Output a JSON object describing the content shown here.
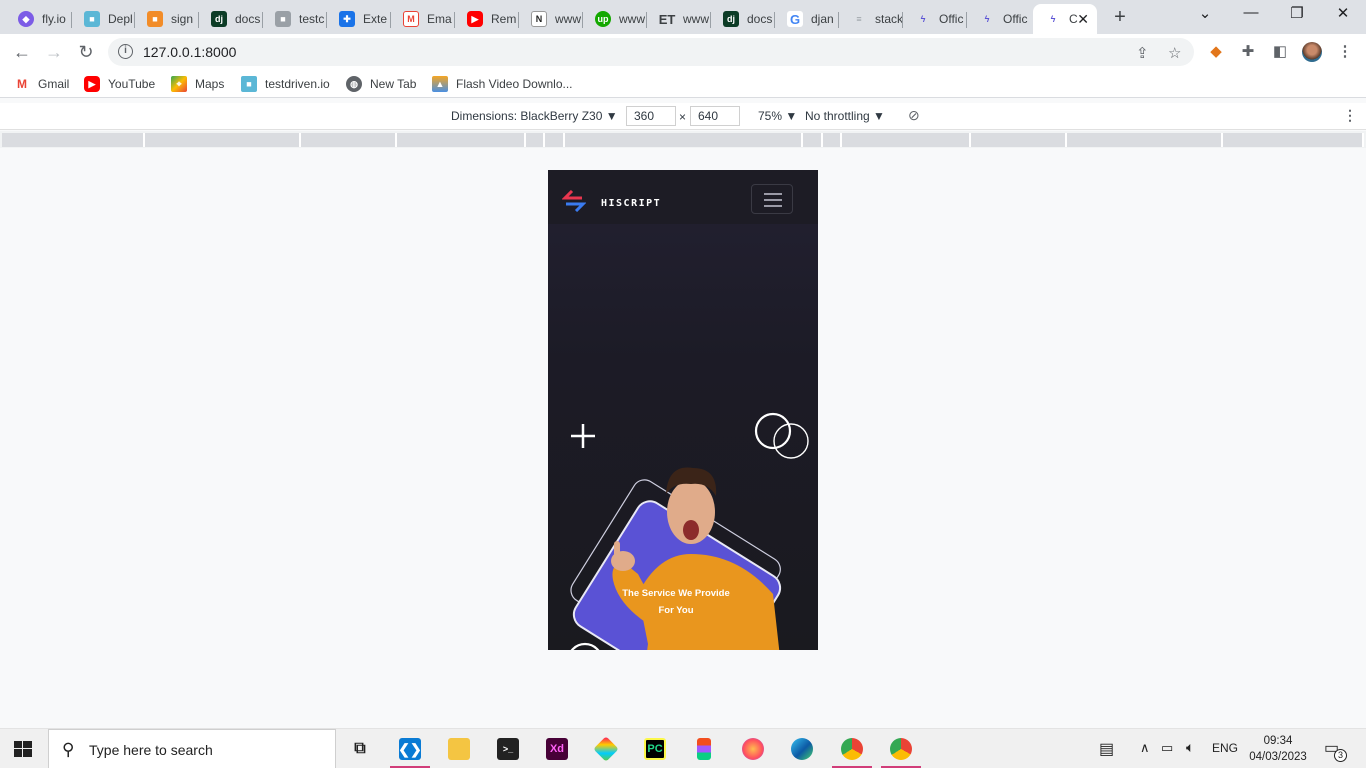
{
  "tabs": [
    {
      "label": "fly.io",
      "icon": "flyio-icon",
      "color": "#7c5ce6"
    },
    {
      "label": "Depl",
      "icon": "cube-icon",
      "color": "#5bb7d6"
    },
    {
      "label": "sign",
      "icon": "box-icon",
      "color": "#f28c28"
    },
    {
      "label": "docs",
      "icon": "django-icon",
      "color": "#0c3c26"
    },
    {
      "label": "testc",
      "icon": "cube-grey-icon",
      "color": "#9aa0a6"
    },
    {
      "label": "Exte",
      "icon": "puzzle-icon",
      "color": "#1a73e8"
    },
    {
      "label": "Ema",
      "icon": "gmail-icon",
      "color": "#ea4335"
    },
    {
      "label": "Rem",
      "icon": "youtube-icon",
      "color": "#ff0000"
    },
    {
      "label": "www",
      "icon": "notion-icon",
      "color": "#ffffff"
    },
    {
      "label": "www",
      "icon": "upwork-icon",
      "color": "#14a800"
    },
    {
      "label": "www",
      "icon": "et-icon",
      "color": "#ffffff"
    },
    {
      "label": "docs",
      "icon": "django-icon",
      "color": "#0c3c26"
    },
    {
      "label": "djan",
      "icon": "google-icon",
      "color": "#ffffff"
    },
    {
      "label": "stack",
      "icon": "stackoverflow-icon",
      "color": "#ffffff"
    },
    {
      "label": "Offic",
      "icon": "hiscript-icon",
      "color": "#ffffff"
    },
    {
      "label": "Offic",
      "icon": "hiscript-icon",
      "color": "#ffffff"
    },
    {
      "label": "C",
      "icon": "hiscript-icon",
      "color": "#ffffff",
      "active": true
    }
  ],
  "address": {
    "url": "127.0.0.1:8000"
  },
  "bookmarks": [
    {
      "label": "Gmail",
      "icon": "gmail-icon"
    },
    {
      "label": "YouTube",
      "icon": "youtube-icon"
    },
    {
      "label": "Maps",
      "icon": "maps-icon"
    },
    {
      "label": "testdriven.io",
      "icon": "cube-icon"
    },
    {
      "label": "New Tab",
      "icon": "globe-icon"
    },
    {
      "label": "Flash Video Downlo...",
      "icon": "flash-icon"
    }
  ],
  "devtools": {
    "dimensions_label": "Dimensions: BlackBerry Z30",
    "width": "360",
    "times": "×",
    "height": "640",
    "zoom": "75%",
    "throttling": "No throttling"
  },
  "site": {
    "brand": "HISCRIPT",
    "service_line1": "The Service We Provide",
    "service_line2": "For You"
  },
  "taskbar": {
    "search_placeholder": "Type here to search",
    "language": "ENG",
    "time": "09:34",
    "date": "04/03/2023",
    "notifications": "3"
  },
  "colors": {
    "accent_pink": "#d13d79",
    "hero_purple": "#5a52d5",
    "shirt_orange": "#e9961e",
    "logo_red": "#e8364f",
    "logo_blue": "#3a7bf0"
  }
}
